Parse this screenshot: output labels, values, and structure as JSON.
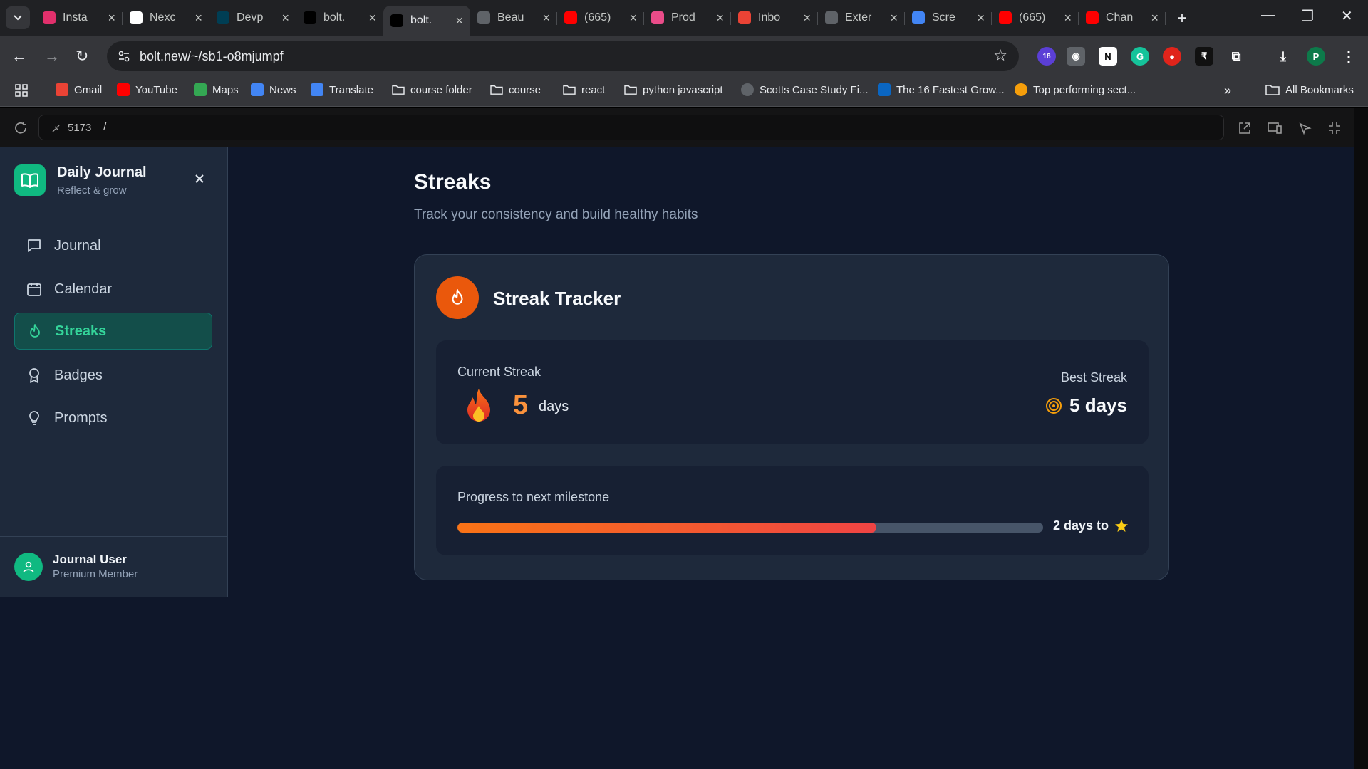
{
  "browser": {
    "tabs": [
      {
        "title": "Insta",
        "icon": "instagram-icon",
        "color": "#e1306c"
      },
      {
        "title": "Nexc",
        "icon": "nexc-icon",
        "color": "#ffffff"
      },
      {
        "title": "Devp",
        "icon": "devpost-icon",
        "color": "#003e54"
      },
      {
        "title": "bolt.",
        "icon": "bolt-icon",
        "color": "#000000"
      },
      {
        "title": "bolt.",
        "icon": "bolt-icon",
        "color": "#000000",
        "active": true
      },
      {
        "title": "Beau",
        "icon": "globe-icon",
        "color": "#5f6368"
      },
      {
        "title": "(665)",
        "icon": "youtube-icon",
        "color": "#ff0000"
      },
      {
        "title": "Prod",
        "icon": "dribbble-icon",
        "color": "#ea4c89"
      },
      {
        "title": "Inbo",
        "icon": "gmail-icon",
        "color": "#ea4335"
      },
      {
        "title": "Exter",
        "icon": "puzzle-icon",
        "color": "#5f6368"
      },
      {
        "title": "Scre",
        "icon": "screenshot-icon",
        "color": "#4285f4"
      },
      {
        "title": "(665)",
        "icon": "youtube-icon",
        "color": "#ff0000"
      },
      {
        "title": "Chan",
        "icon": "youtube-icon",
        "color": "#ff0000"
      }
    ],
    "url": "bolt.new/~/sb1-o8mjumpf",
    "extension_badge": "18",
    "profile_initial": "P",
    "bookmarks": [
      {
        "label": "Gmail",
        "icon": "gmail-icon"
      },
      {
        "label": "YouTube",
        "icon": "youtube-icon"
      },
      {
        "label": "Maps",
        "icon": "maps-icon"
      },
      {
        "label": "News",
        "icon": "news-icon"
      },
      {
        "label": "Translate",
        "icon": "translate-icon"
      },
      {
        "label": "course folder",
        "icon": "folder-icon"
      },
      {
        "label": "course",
        "icon": "folder-icon"
      },
      {
        "label": "react",
        "icon": "folder-icon"
      },
      {
        "label": "python javascript",
        "icon": "folder-icon"
      },
      {
        "label": "Scotts Case Study Fi...",
        "icon": "globe-icon"
      },
      {
        "label": "The 16 Fastest Grow...",
        "icon": "linkedin-icon"
      },
      {
        "label": "Top performing sect...",
        "icon": "medium-icon"
      }
    ],
    "all_bookmarks": "All Bookmarks"
  },
  "preview": {
    "port": "5173",
    "path": "/"
  },
  "sidebar": {
    "app_title": "Daily Journal",
    "app_subtitle": "Reflect & grow",
    "items": [
      {
        "label": "Journal",
        "icon": "message-square-icon"
      },
      {
        "label": "Calendar",
        "icon": "calendar-icon"
      },
      {
        "label": "Streaks",
        "icon": "flame-icon",
        "active": true
      },
      {
        "label": "Badges",
        "icon": "award-icon"
      },
      {
        "label": "Prompts",
        "icon": "lightbulb-icon"
      }
    ],
    "user_name": "Journal User",
    "user_role": "Premium Member"
  },
  "main": {
    "title": "Streaks",
    "subtitle": "Track your consistency and build healthy habits",
    "card_title": "Streak Tracker",
    "current_label": "Current Streak",
    "current_value": "5",
    "current_unit": "days",
    "best_label": "Best Streak",
    "best_value": "5 days",
    "progress_label": "Progress to next milestone",
    "progress_fraction": 0.715,
    "progress_text": "2 days to"
  },
  "colors": {
    "accent": "#10b981",
    "streak_orange": "#ea580c",
    "background": "#0f172a"
  }
}
